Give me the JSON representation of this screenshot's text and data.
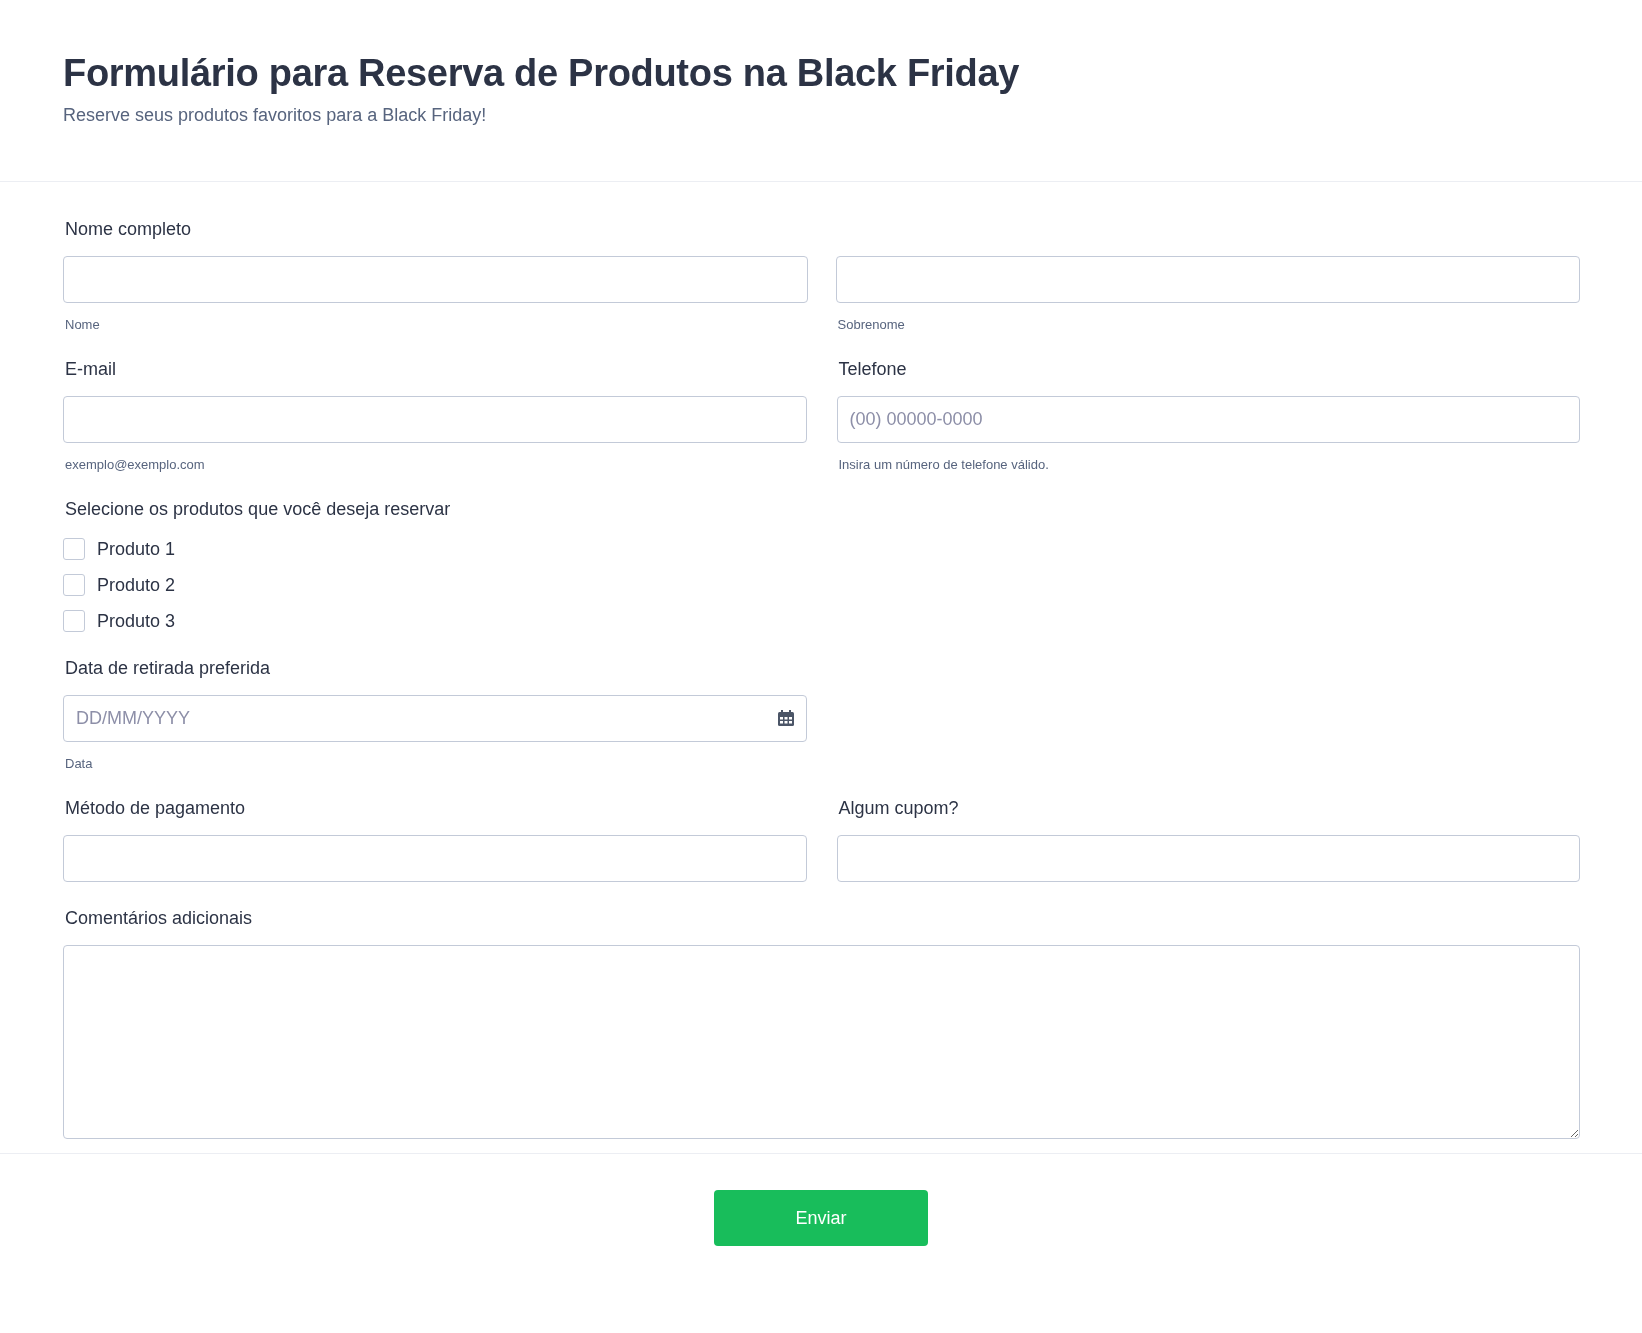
{
  "header": {
    "title": "Formulário para Reserva de Produtos na Black Friday",
    "subtitle": "Reserve seus produtos favoritos para a Black Friday!"
  },
  "sections": [
    {
      "kind": "fullname",
      "label": "Nome completo",
      "inputs": [
        {
          "sublabel": "Nome"
        },
        {
          "sublabel": "Sobrenome"
        }
      ]
    },
    {
      "kind": "pair",
      "fields": [
        {
          "label": "E-mail",
          "sublabel": "exemplo@exemplo.com"
        },
        {
          "label": "Telefone",
          "placeholder": "(00) 00000-0000",
          "sublabel": "Insira um número de telefone válido."
        }
      ]
    },
    {
      "kind": "checkboxes",
      "label": "Selecione os produtos que você deseja reservar",
      "options": [
        {
          "label": "Produto 1",
          "checked": false
        },
        {
          "label": "Produto 2",
          "checked": false
        },
        {
          "label": "Produto 3",
          "checked": false
        }
      ]
    },
    {
      "kind": "date",
      "label": "Data de retirada preferida",
      "placeholder": "DD/MM/YYYY",
      "sublabel": "Data"
    },
    {
      "kind": "pair",
      "fields": [
        {
          "label": "Método de pagamento"
        },
        {
          "label": "Algum cupom?"
        }
      ]
    },
    {
      "kind": "textarea",
      "label": "Comentários adicionais"
    }
  ],
  "submit": {
    "label": "Enviar"
  }
}
